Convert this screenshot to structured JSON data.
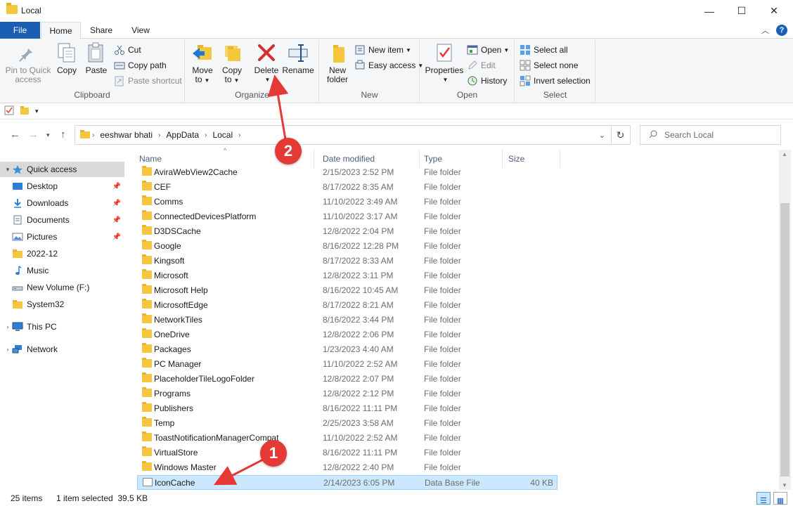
{
  "window": {
    "title": "Local",
    "minimize": "—",
    "maximize": "☐",
    "close": "✕"
  },
  "tabs": {
    "file": "File",
    "home": "Home",
    "share": "Share",
    "view": "View"
  },
  "ribbon": {
    "clipboard": {
      "label": "Clipboard",
      "pin_line1": "Pin to Quick",
      "pin_line2": "access",
      "copy": "Copy",
      "paste": "Paste",
      "cut": "Cut",
      "copy_path": "Copy path",
      "paste_shortcut": "Paste shortcut"
    },
    "organize": {
      "label": "Organize",
      "move_line1": "Move",
      "move_line2": "to",
      "copy_line1": "Copy",
      "copy_line2": "to",
      "delete": "Delete",
      "rename": "Rename"
    },
    "new": {
      "label": "New",
      "folder_line1": "New",
      "folder_line2": "folder",
      "new_item": "New item",
      "easy_access": "Easy access"
    },
    "open": {
      "label": "Open",
      "properties": "Properties",
      "open": "Open",
      "edit": "Edit",
      "history": "History"
    },
    "select": {
      "label": "Select",
      "select_all": "Select all",
      "select_none": "Select none",
      "invert": "Invert selection"
    }
  },
  "address": {
    "crumbs": [
      "eeshwar bhati",
      "AppData",
      "Local"
    ]
  },
  "search": {
    "placeholder": "Search Local"
  },
  "nav": {
    "quick_access": "Quick access",
    "items": [
      "Desktop",
      "Downloads",
      "Documents",
      "Pictures",
      "2022-12",
      "Music",
      "New Volume (F:)",
      "System32"
    ],
    "this_pc": "This PC",
    "network": "Network"
  },
  "columns": {
    "name": "Name",
    "date": "Date modified",
    "type": "Type",
    "size": "Size"
  },
  "files": [
    {
      "name": "AviraWebView2Cache",
      "date": "2/15/2023 2:52 PM",
      "type": "File folder",
      "size": ""
    },
    {
      "name": "CEF",
      "date": "8/17/2022 8:35 AM",
      "type": "File folder",
      "size": ""
    },
    {
      "name": "Comms",
      "date": "11/10/2022 3:49 AM",
      "type": "File folder",
      "size": ""
    },
    {
      "name": "ConnectedDevicesPlatform",
      "date": "11/10/2022 3:17 AM",
      "type": "File folder",
      "size": ""
    },
    {
      "name": "D3DSCache",
      "date": "12/8/2022 2:04 PM",
      "type": "File folder",
      "size": ""
    },
    {
      "name": "Google",
      "date": "8/16/2022 12:28 PM",
      "type": "File folder",
      "size": ""
    },
    {
      "name": "Kingsoft",
      "date": "8/17/2022 8:33 AM",
      "type": "File folder",
      "size": ""
    },
    {
      "name": "Microsoft",
      "date": "12/8/2022 3:11 PM",
      "type": "File folder",
      "size": ""
    },
    {
      "name": "Microsoft Help",
      "date": "8/16/2022 10:45 AM",
      "type": "File folder",
      "size": ""
    },
    {
      "name": "MicrosoftEdge",
      "date": "8/17/2022 8:21 AM",
      "type": "File folder",
      "size": ""
    },
    {
      "name": "NetworkTiles",
      "date": "8/16/2022 3:44 PM",
      "type": "File folder",
      "size": ""
    },
    {
      "name": "OneDrive",
      "date": "12/8/2022 2:06 PM",
      "type": "File folder",
      "size": ""
    },
    {
      "name": "Packages",
      "date": "1/23/2023 4:40 AM",
      "type": "File folder",
      "size": ""
    },
    {
      "name": "PC Manager",
      "date": "11/10/2022 2:52 AM",
      "type": "File folder",
      "size": ""
    },
    {
      "name": "PlaceholderTileLogoFolder",
      "date": "12/8/2022 2:07 PM",
      "type": "File folder",
      "size": ""
    },
    {
      "name": "Programs",
      "date": "12/8/2022 2:12 PM",
      "type": "File folder",
      "size": ""
    },
    {
      "name": "Publishers",
      "date": "8/16/2022 11:11 PM",
      "type": "File folder",
      "size": ""
    },
    {
      "name": "Temp",
      "date": "2/25/2023 3:58 AM",
      "type": "File folder",
      "size": ""
    },
    {
      "name": "ToastNotificationManagerCompat",
      "date": "11/10/2022 2:52 AM",
      "type": "File folder",
      "size": ""
    },
    {
      "name": "VirtualStore",
      "date": "8/16/2022 11:11 PM",
      "type": "File folder",
      "size": ""
    },
    {
      "name": "Windows Master",
      "date": "12/8/2022 2:40 PM",
      "type": "File folder",
      "size": ""
    },
    {
      "name": "IconCache",
      "date": "2/14/2023 6:05 PM",
      "type": "Data Base File",
      "size": "40 KB"
    }
  ],
  "status": {
    "items": "25 items",
    "selected": "1 item selected  39.5 KB"
  },
  "annotations": {
    "step1": "1",
    "step2": "2"
  },
  "colors": {
    "accent": "#1a5fb4",
    "selection": "#cce8ff",
    "folder": "#f5c73e",
    "annotation": "#e53935",
    "delete_x": "#d32f2f"
  }
}
